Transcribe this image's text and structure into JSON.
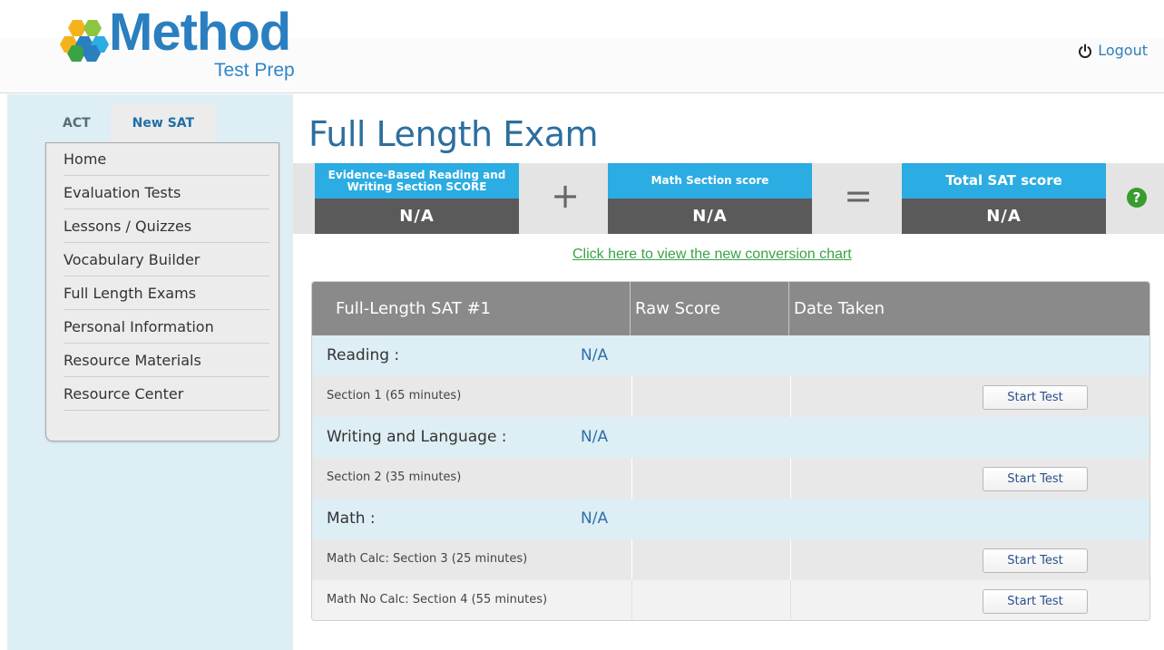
{
  "header": {
    "logo_word": "Method",
    "logo_sub": "Test Prep",
    "logout_label": "Logout"
  },
  "sidebar": {
    "tabs": [
      {
        "label": "ACT",
        "active": false
      },
      {
        "label": "New SAT",
        "active": true
      }
    ],
    "items": [
      {
        "label": "Home"
      },
      {
        "label": "Evaluation Tests"
      },
      {
        "label": "Lessons / Quizzes"
      },
      {
        "label": "Vocabulary Builder"
      },
      {
        "label": "Full Length Exams"
      },
      {
        "label": "Personal Information"
      },
      {
        "label": "Resource Materials"
      },
      {
        "label": "Resource Center"
      }
    ]
  },
  "main": {
    "title": "Full Length Exam",
    "scores": {
      "reading_label": "Evidence-Based Reading and Writing Section SCORE",
      "reading_value": "N/A",
      "plus": "+",
      "math_label": "Math Section score",
      "math_value": "N/A",
      "equals": "=",
      "total_label": "Total SAT score",
      "total_value": "N/A",
      "help": "?"
    },
    "conversion_link": "Click here to view the new conversion chart",
    "table": {
      "headers": [
        "Full-Length SAT #1",
        "Raw Score",
        "Date Taken"
      ],
      "sections": [
        {
          "name": "Reading :",
          "value": "N/A"
        },
        {
          "name": "Writing and Language :",
          "value": "N/A"
        },
        {
          "name": "Math :",
          "value": "N/A"
        }
      ],
      "subsections": [
        {
          "name": "Section 1 (65 minutes)",
          "button": "Start Test"
        },
        {
          "name": "Section 2 (35 minutes)",
          "button": "Start Test"
        },
        {
          "name": "Math Calc: Section 3 (25 minutes)",
          "button": "Start Test"
        },
        {
          "name": "Math No Calc: Section 4 (55 minutes)",
          "button": "Start Test"
        }
      ]
    }
  },
  "colors": {
    "brand_blue": "#2a7fc0",
    "score_label_bg": "#2bace2",
    "score_value_bg": "#5a5a5a",
    "link_green": "#3aa346",
    "help_green": "#3a9b2f",
    "table_header_bg": "#8a8a8a",
    "section_row_bg": "#ddeef4"
  },
  "icons": {
    "logout": "power-icon",
    "help": "help-icon",
    "logo": "hexagon-cluster-icon"
  }
}
